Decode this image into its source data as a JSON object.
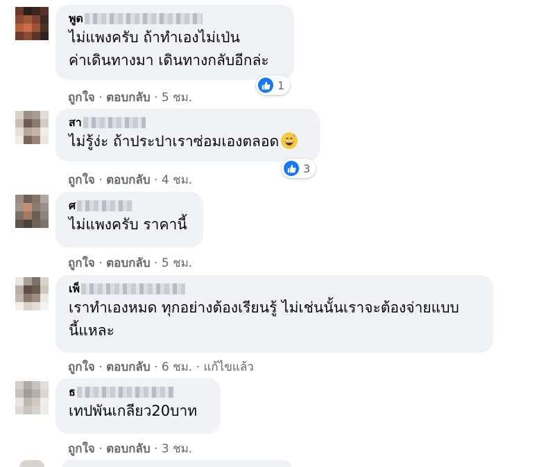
{
  "comments": [
    {
      "author_visible": "พูด",
      "text_lines": [
        "ไม่แพงครับ ถ้าทำเองไม่เป่น",
        "ค่าเดินทางมา เดินทางกลับอีกล่ะ"
      ],
      "like_label": "ถูกใจ",
      "reply_label": "ตอบกลับ",
      "time": "5 ชม.",
      "reaction_count": "1"
    },
    {
      "author_visible": "สา",
      "text_lines": [
        "ไม่รู้ง่ะ ถ้าประปาเราซ่อมเองตลอด"
      ],
      "like_label": "ถูกใจ",
      "reply_label": "ตอบกลับ",
      "time": "4 ชม.",
      "reaction_count": "3"
    },
    {
      "author_visible": "ศ",
      "text_lines": [
        "ไม่แพงครับ ราคานี้"
      ],
      "like_label": "ถูกใจ",
      "reply_label": "ตอบกลับ",
      "time": "5 ชม."
    },
    {
      "author_visible": "เพ็",
      "text_lines": [
        "เราทำเองหมด ทุกอย่างต้องเรียนรู้ ไม่เช่นนั้นเราจะต้องจ่ายแบบ",
        "นี้แหละ"
      ],
      "like_label": "ถูกใจ",
      "reply_label": "ตอบกลับ",
      "time": "6 ชม.",
      "edited_label": "แก้ไขแล้ว"
    },
    {
      "author_visible": "ธ",
      "text_lines": [
        "เทปพันเกลียว20บาท"
      ],
      "like_label": "ถูกใจ",
      "reply_label": "ตอบกลับ",
      "time": "3 ชม."
    }
  ],
  "separator": " · ",
  "colors": {
    "bubble": "#f0f2f5",
    "meta": "#65676b",
    "like_blue": "#1877f2",
    "text": "#050505"
  },
  "icons": {
    "reaction": "thumbs-up-icon",
    "emoji": "grinning-sweat-emoji-icon"
  }
}
